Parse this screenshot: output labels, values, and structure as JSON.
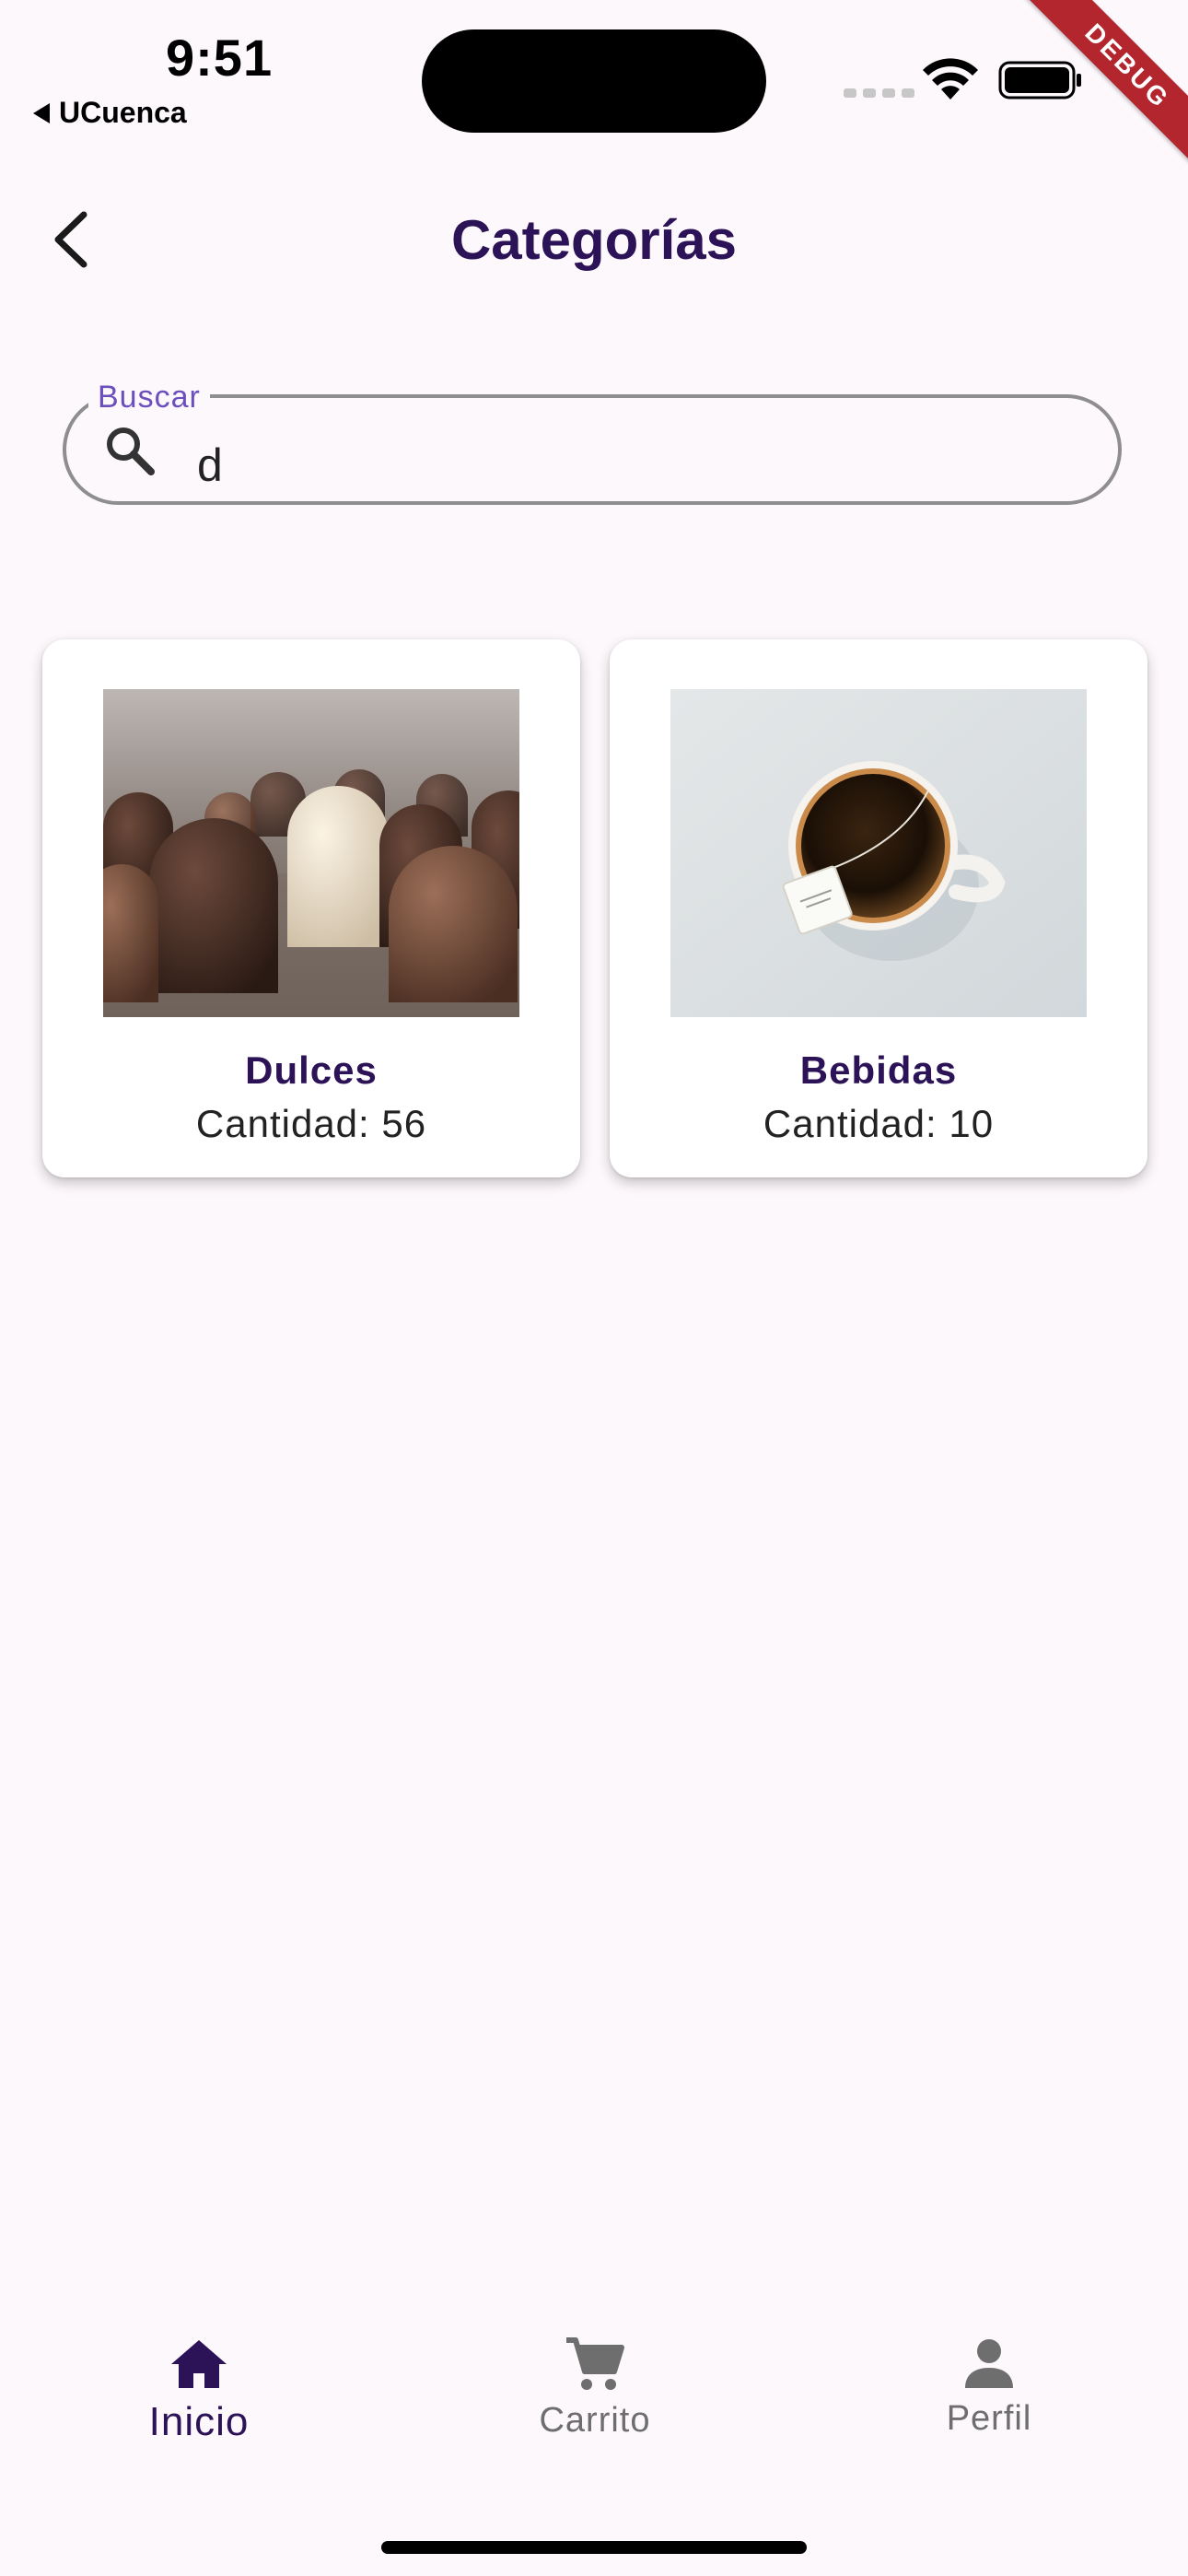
{
  "status_bar": {
    "time": "9:51",
    "back_app": "UCuenca",
    "debug_label": "DEBUG"
  },
  "app_bar": {
    "title": "Categorías"
  },
  "search": {
    "label": "Buscar",
    "value": "d"
  },
  "categories": [
    {
      "name": "Dulces",
      "count_text": "Cantidad: 56",
      "image_icon": "chocolates-photo"
    },
    {
      "name": "Bebidas",
      "count_text": "Cantidad: 10",
      "image_icon": "tea-cup-photo"
    }
  ],
  "bottom_nav": {
    "items": [
      {
        "label": "Inicio",
        "icon": "home-icon",
        "active": true
      },
      {
        "label": "Carrito",
        "icon": "cart-icon",
        "active": false
      },
      {
        "label": "Perfil",
        "icon": "person-icon",
        "active": false
      }
    ]
  },
  "colors": {
    "background": "#fdf8fc",
    "primary_dark": "#2c1257",
    "label_purple": "#6b4fbd",
    "inactive": "#6e6e6e",
    "debug_red": "#b3262e"
  }
}
